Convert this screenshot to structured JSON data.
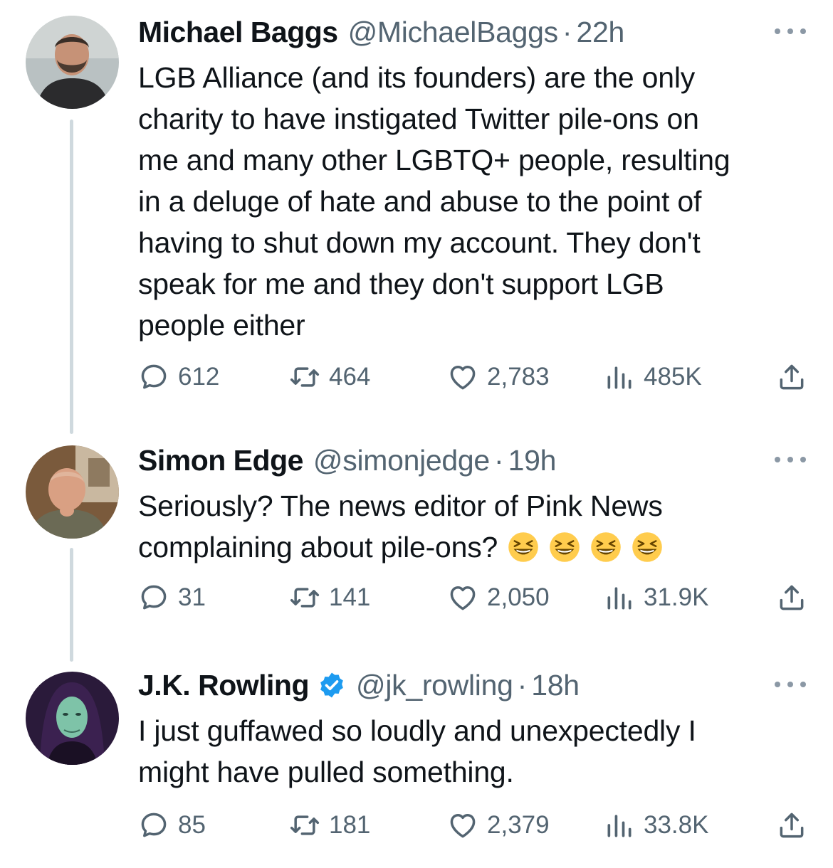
{
  "tweets": [
    {
      "name": "Michael Baggs",
      "handle": "@MichaelBaggs",
      "dot": "·",
      "time": "22h",
      "text": "LGB Alliance (and its founders) are the only\ncharity to have instigated Twitter pile-ons on\nme and many other LGBTQ+ people, resulting\nin a deluge of hate and abuse to the point of\nhaving to shut down my account. They don't\nspeak for me and they don't support LGB\npeople either",
      "replies": "612",
      "retweets": "464",
      "likes": "2,783",
      "views": "485K",
      "avatar": {
        "bg": "#b9c1c2",
        "skin": "#c69277",
        "hair": "#3a2e27",
        "shirt": "#2b2b2d"
      }
    },
    {
      "name": "Simon Edge",
      "handle": "@simonjedge",
      "dot": "·",
      "time": "19h",
      "text": "Seriously? The news editor of Pink News\ncomplaining about pile-ons?",
      "emoji_count": 4,
      "replies": "31",
      "retweets": "141",
      "likes": "2,050",
      "views": "31.9K",
      "avatar": {
        "bg": "#7a5a3c",
        "skin": "#d9a083",
        "hair": "#e0b59c",
        "shirt": "#6b6a55"
      }
    },
    {
      "name": "J.K. Rowling",
      "handle": "@jk_rowling",
      "dot": "·",
      "time": "18h",
      "verified": true,
      "text": "I just guffawed so loudly and unexpectedly I\nmight have pulled something.",
      "replies": "85",
      "retweets": "181",
      "likes": "2,379",
      "views": "33.8K",
      "avatar": {
        "bg": "#2a1a3a",
        "skin": "#7ec3a8",
        "hair": "#3b2150",
        "shirt": "#1a1024"
      }
    }
  ],
  "icons": {
    "reply": "reply-icon",
    "retweet": "retweet-icon",
    "like": "heart-icon",
    "views": "views-icon",
    "share": "share-icon",
    "more": "more-icon",
    "verified": "verified-badge-icon",
    "emoji": "grinning-squinting-face-emoji"
  },
  "colors": {
    "text": "#0f1419",
    "secondary": "#536471",
    "thread_line": "#cfd9de",
    "verified": "#1d9bf0"
  }
}
